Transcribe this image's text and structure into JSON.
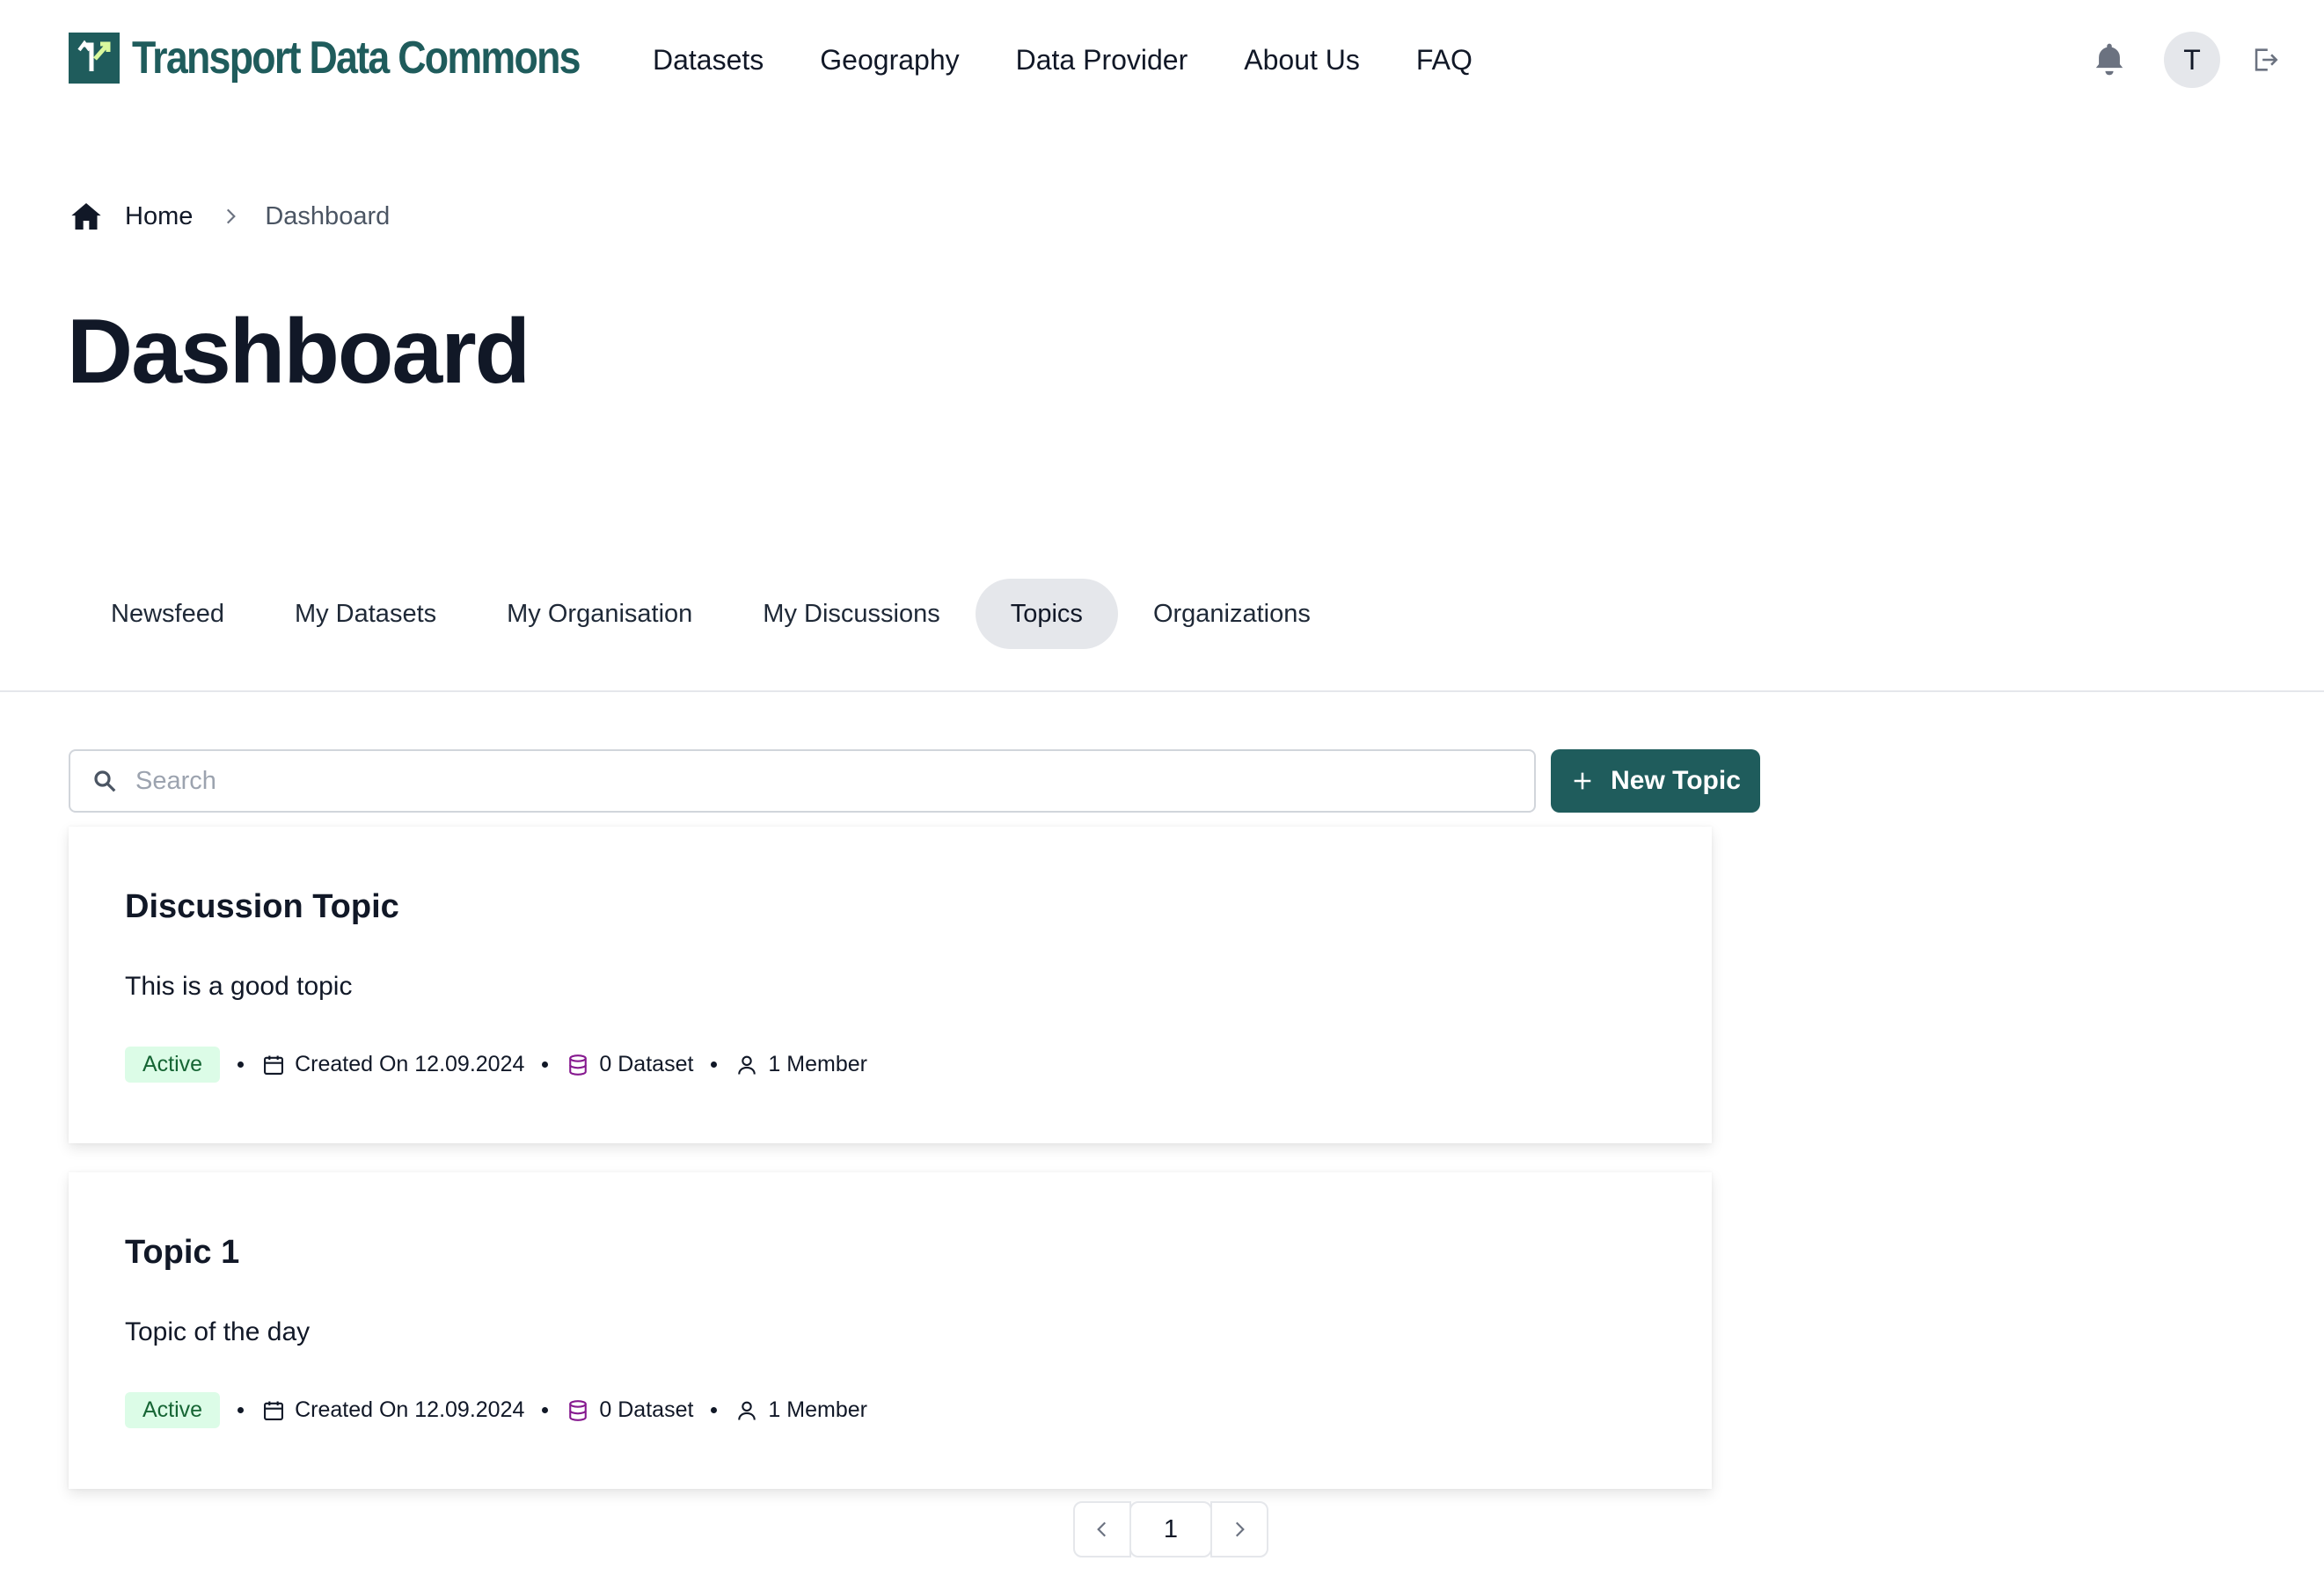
{
  "brand": {
    "name": "Transport Data Commons",
    "color": "#1f5c5c"
  },
  "nav": [
    {
      "label": "Datasets"
    },
    {
      "label": "Geography"
    },
    {
      "label": "Data Provider"
    },
    {
      "label": "About Us"
    },
    {
      "label": "FAQ"
    }
  ],
  "user": {
    "initial": "T"
  },
  "icons": {
    "notifications": "bell-icon",
    "logout": "logout-icon",
    "home": "home-icon"
  },
  "breadcrumb": {
    "home": "Home",
    "current": "Dashboard"
  },
  "page": {
    "title": "Dashboard"
  },
  "tabs": [
    {
      "label": "Newsfeed",
      "active": false
    },
    {
      "label": "My Datasets",
      "active": false
    },
    {
      "label": "My Organisation",
      "active": false
    },
    {
      "label": "My Discussions",
      "active": false
    },
    {
      "label": "Topics",
      "active": true
    },
    {
      "label": "Organizations",
      "active": false
    }
  ],
  "search": {
    "placeholder": "Search",
    "value": ""
  },
  "actions": {
    "new_topic": "New Topic"
  },
  "topics": [
    {
      "title": "Discussion Topic",
      "description": "This is a good topic",
      "status": "Active",
      "created": "Created On 12.09.2024",
      "datasets": "0 Dataset",
      "members": "1 Member"
    },
    {
      "title": "Topic 1",
      "description": "Topic of the day",
      "status": "Active",
      "created": "Created On 12.09.2024",
      "datasets": "0 Dataset",
      "members": "1 Member"
    }
  ],
  "pagination": {
    "current": "1"
  },
  "colors": {
    "accent": "#1f5c5c",
    "active_badge_bg": "#dcfce7",
    "active_badge_text": "#166534",
    "dataset_icon": "#86198f"
  }
}
